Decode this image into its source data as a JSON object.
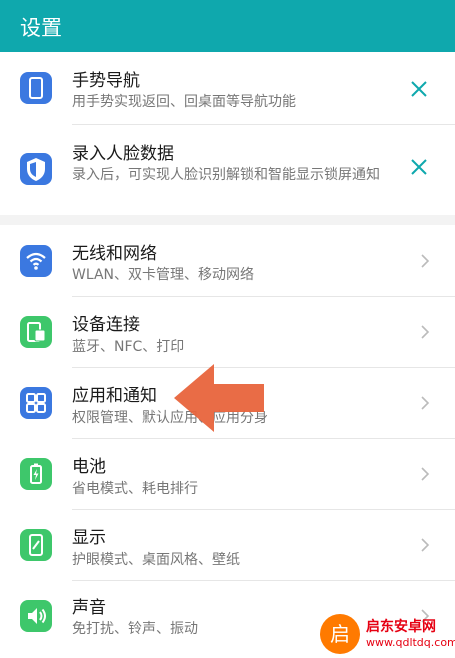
{
  "header": {
    "title": "设置"
  },
  "suggestions": [
    {
      "title": "手势导航",
      "subtitle": "用手势实现返回、回桌面等导航功能",
      "icon": "phone-icon"
    },
    {
      "title": "录入人脸数据",
      "subtitle": "录入后，可实现人脸识别解锁和智能显示锁屏通知",
      "icon": "shield-icon"
    }
  ],
  "settings": [
    {
      "title": "无线和网络",
      "subtitle": "WLAN、双卡管理、移动网络",
      "icon": "wifi-icon"
    },
    {
      "title": "设备连接",
      "subtitle": "蓝牙、NFC、打印",
      "icon": "device-connection-icon"
    },
    {
      "title": "应用和通知",
      "subtitle": "权限管理、默认应用、应用分身",
      "icon": "apps-grid-icon"
    },
    {
      "title": "电池",
      "subtitle": "省电模式、耗电排行",
      "icon": "battery-icon"
    },
    {
      "title": "显示",
      "subtitle": "护眼模式、桌面风格、壁纸",
      "icon": "display-icon"
    },
    {
      "title": "声音",
      "subtitle": "免打扰、铃声、振动",
      "icon": "speaker-icon"
    }
  ],
  "watermark": {
    "badge": "启",
    "name": "启东安卓网",
    "url": "www.qdltdq.com"
  },
  "colors": {
    "header": "#0fa8ad",
    "accent": "#0fa8ad",
    "icon_blue": "#3b78e0",
    "icon_green": "#3ec76b",
    "arrow": "#e8643c"
  }
}
